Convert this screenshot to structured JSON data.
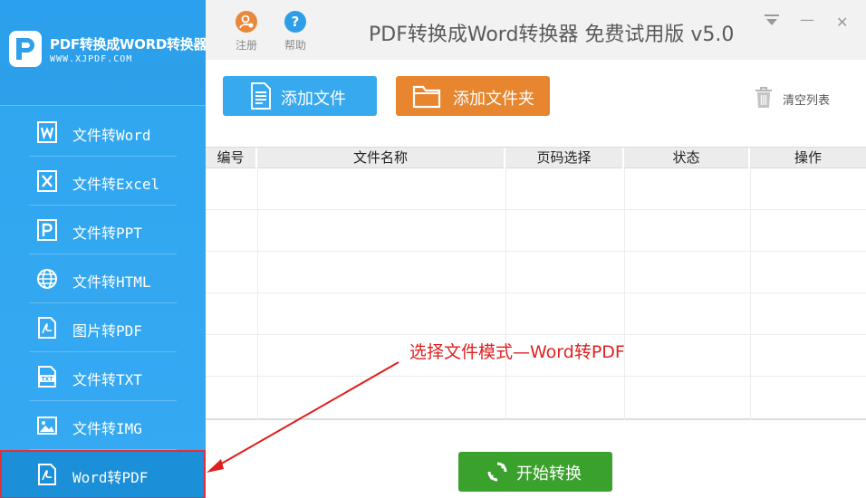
{
  "brand": {
    "title": "PDF转换成WORD转换器",
    "url": "WWW.XJPDF.COM"
  },
  "sidebar": {
    "items": [
      {
        "label": "文件转Word",
        "icon": "word-icon",
        "active": false
      },
      {
        "label": "文件转Excel",
        "icon": "excel-icon",
        "active": false
      },
      {
        "label": "文件转PPT",
        "icon": "ppt-icon",
        "active": false
      },
      {
        "label": "文件转HTML",
        "icon": "globe-icon",
        "active": false
      },
      {
        "label": "图片转PDF",
        "icon": "pdf-icon",
        "active": false
      },
      {
        "label": "文件转TXT",
        "icon": "txt-icon",
        "active": false
      },
      {
        "label": "文件转IMG",
        "icon": "image-icon",
        "active": false
      },
      {
        "label": "Word转PDF",
        "icon": "pdf-icon",
        "active": true
      }
    ]
  },
  "topbar": {
    "register_label": "注册",
    "help_label": "帮助",
    "title": "PDF转换成Word转换器 免费试用版 v5.0",
    "minimize_symbol": "—",
    "close_symbol": "✕"
  },
  "toolbar": {
    "add_file_label": "添加文件",
    "add_folder_label": "添加文件夹",
    "clear_list_label": "清空列表"
  },
  "table": {
    "columns": [
      "编号",
      "文件名称",
      "页码选择",
      "状态",
      "操作"
    ],
    "rows": []
  },
  "annotation": {
    "text": "选择文件模式—Word转PDF"
  },
  "start_button": {
    "label": "开始转换"
  },
  "colors": {
    "sidebar_bg": "#36a9f2",
    "add_file_bg": "#37a9ef",
    "add_folder_bg": "#e7862e",
    "start_bg": "#3aa12d",
    "annotation": "#e01f1f"
  }
}
